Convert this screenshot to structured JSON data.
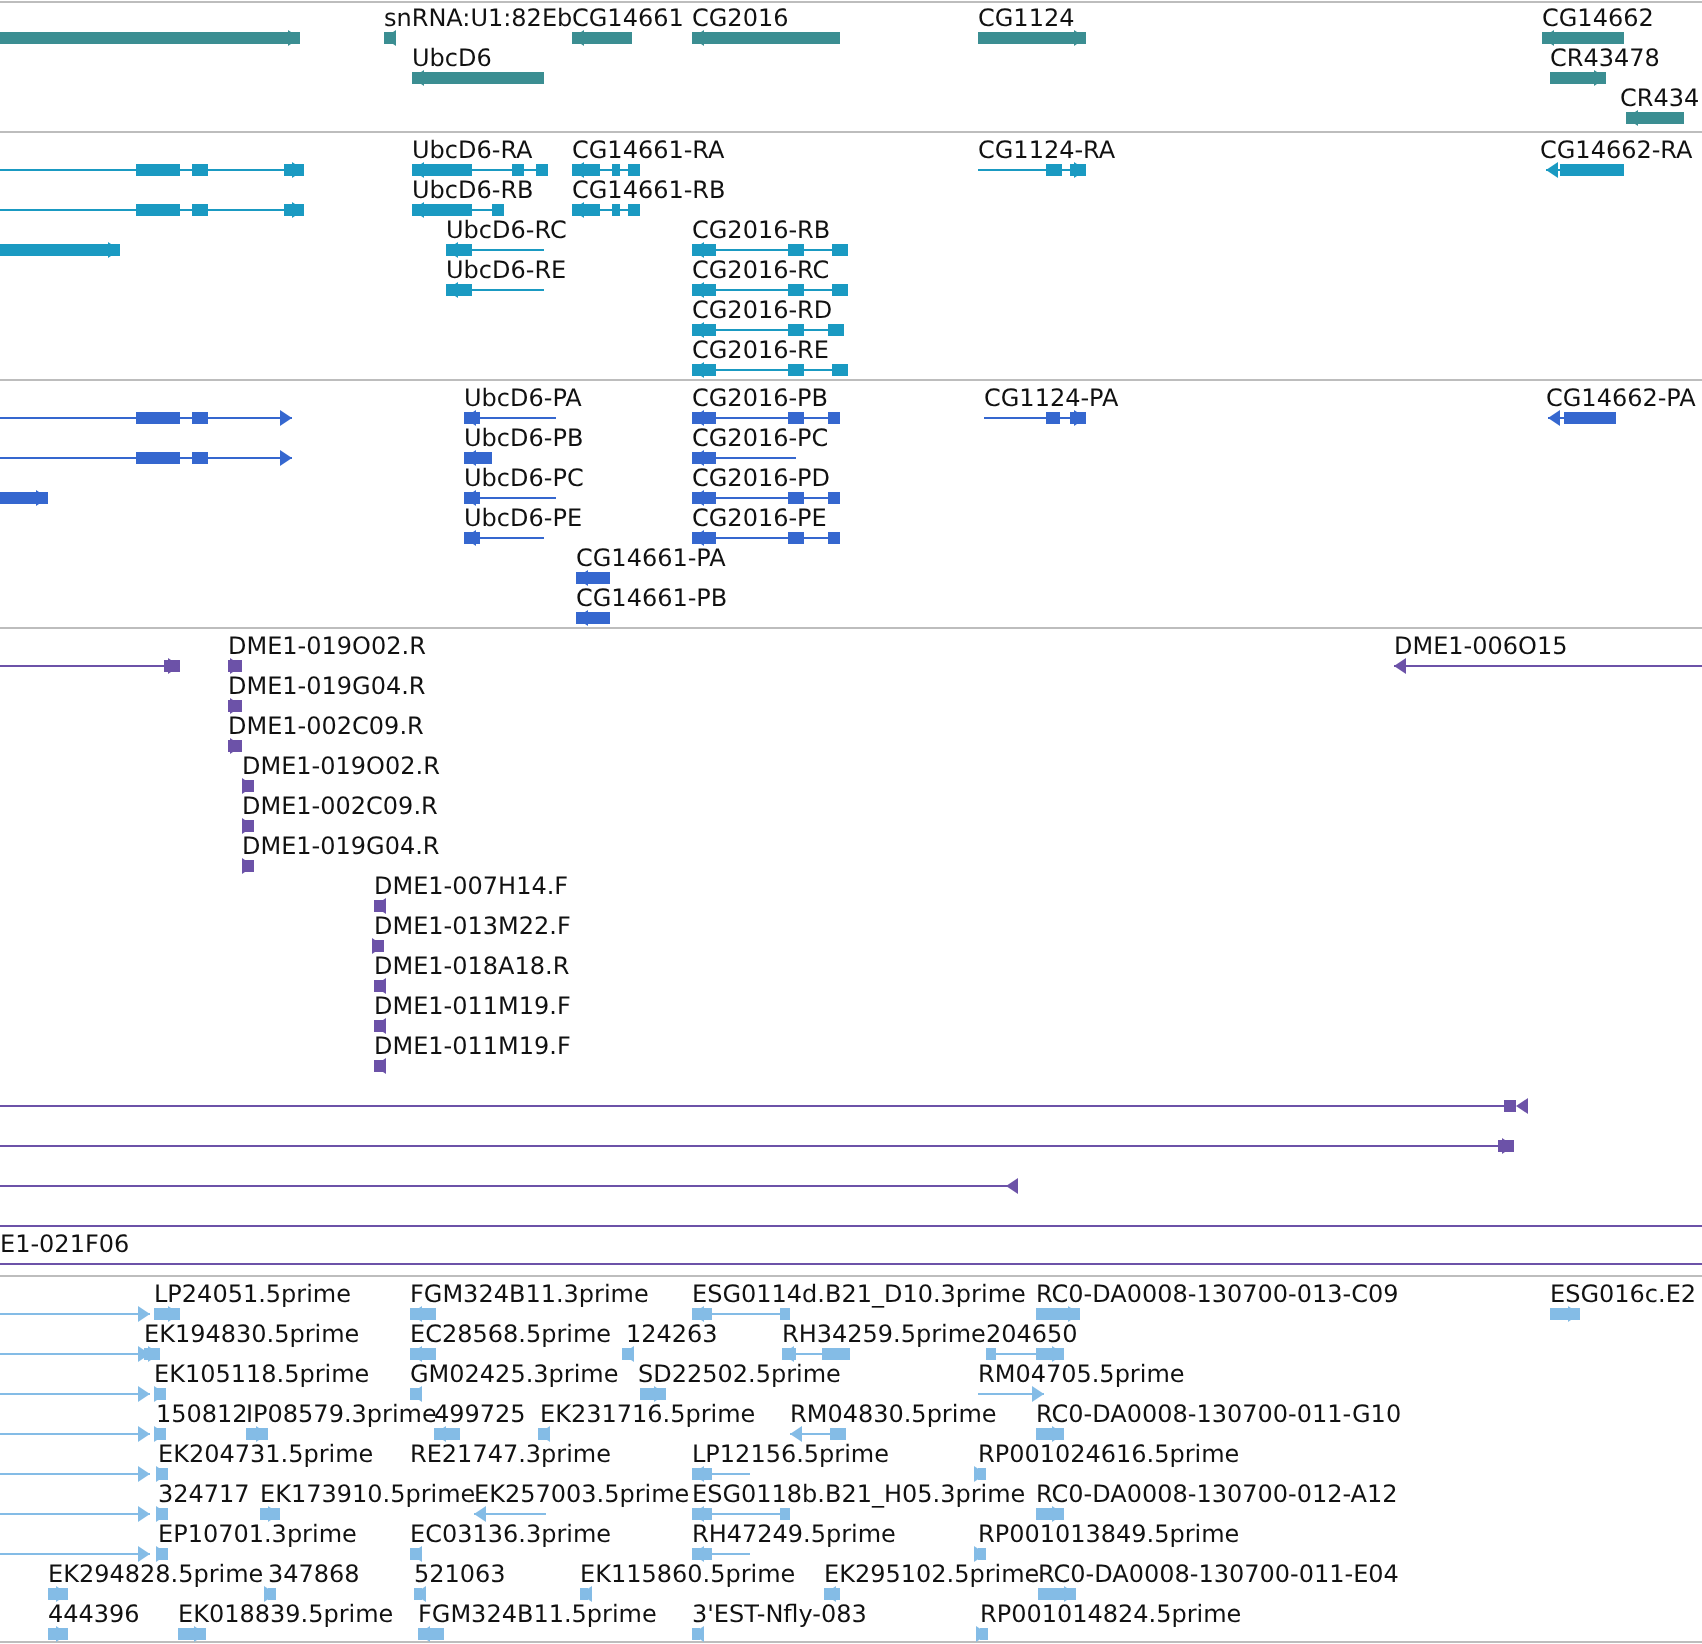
{
  "tracks": [
    {
      "kind": "gene",
      "features": [
        {
          "reverse": false
        },
        {
          "label": "snRNA:U1:82Eb",
          "reverse": true
        },
        {
          "label": "CG14661",
          "reverse": true
        },
        {
          "label": "CG2016",
          "reverse": true
        },
        {
          "label": "CG1124",
          "reverse": false
        },
        {
          "label": "CG14662",
          "reverse": true
        },
        {
          "label": "UbcD6",
          "reverse": true
        },
        {
          "label": "CR43478",
          "reverse": false
        },
        {
          "label": "CR434",
          "reverse": true
        }
      ]
    },
    {
      "kind": "transcript",
      "features": [
        {
          "reverse": false
        },
        {
          "reverse": false
        },
        {
          "reverse": false
        },
        {
          "label": "UbcD6-RA",
          "reverse": true
        },
        {
          "label": "CG14661-RA",
          "reverse": true
        },
        {
          "label": "CG1124-RA",
          "reverse": false
        },
        {
          "label": "CG14662-RA",
          "reverse": true
        },
        {
          "label": "UbcD6-RB",
          "reverse": true
        },
        {
          "label": "CG14661-RB",
          "reverse": true
        },
        {
          "label": "UbcD6-RC",
          "reverse": true
        },
        {
          "label": "UbcD6-RE",
          "reverse": true
        },
        {
          "label": "CG2016-RB",
          "reverse": true
        },
        {
          "label": "CG2016-RC",
          "reverse": true
        },
        {
          "label": "CG2016-RD",
          "reverse": true
        },
        {
          "label": "CG2016-RE",
          "reverse": true
        }
      ]
    },
    {
      "kind": "protein",
      "features": [
        {
          "reverse": false
        },
        {
          "reverse": false
        },
        {
          "reverse": false
        },
        {
          "label": "UbcD6-PA",
          "reverse": true
        },
        {
          "label": "CG2016-PB",
          "reverse": true
        },
        {
          "label": "CG1124-PA",
          "reverse": false
        },
        {
          "label": "CG14662-PA",
          "reverse": true
        },
        {
          "label": "UbcD6-PB",
          "reverse": true
        },
        {
          "label": "CG2016-PC",
          "reverse": true
        },
        {
          "label": "UbcD6-PC",
          "reverse": true
        },
        {
          "label": "CG2016-PD",
          "reverse": true
        },
        {
          "label": "UbcD6-PE",
          "reverse": true
        },
        {
          "label": "CG2016-PE",
          "reverse": true
        },
        {
          "label": "CG14661-PA",
          "reverse": true
        },
        {
          "label": "CG14661-PB",
          "reverse": true
        }
      ]
    },
    {
      "kind": "clone",
      "features": [
        {
          "reverse": false
        },
        {
          "label": "DME1-019O02.R",
          "reverse": false
        },
        {
          "label": "DME1-006O15",
          "reverse": true
        },
        {
          "label": "DME1-019G04.R",
          "reverse": false
        },
        {
          "label": "DME1-002C09.R",
          "reverse": false
        },
        {
          "label": "DME1-019O02.R",
          "reverse": false
        },
        {
          "label": "DME1-002C09.R",
          "reverse": false
        },
        {
          "label": "DME1-019G04.R",
          "reverse": false
        },
        {
          "label": "DME1-007H14.F",
          "reverse": true
        },
        {
          "label": "DME1-013M22.F",
          "reverse": false
        },
        {
          "label": "DME1-018A18.R",
          "reverse": true
        },
        {
          "label": "DME1-011M19.F",
          "reverse": true
        },
        {
          "label": "DME1-011M19.F",
          "reverse": true
        },
        {
          "reverse": true
        },
        {
          "reverse": false
        },
        {
          "reverse": true
        },
        {
          "reverse": false
        },
        {
          "label": "E1-021F06",
          "reverse": false
        }
      ]
    },
    {
      "kind": "est",
      "features": [
        {
          "reverse": false
        },
        {
          "label": "LP24051.5prime",
          "reverse": false
        },
        {
          "label": "FGM324B11.3prime",
          "reverse": true
        },
        {
          "label": "ESG0114d.B21_D10.3prime",
          "reverse": true
        },
        {
          "label": "RC0-DA0008-130700-013-C09",
          "reverse": false
        },
        {
          "label": "ESG016c.E2",
          "reverse": false
        },
        {
          "reverse": false
        },
        {
          "label": "EK194830.5prime",
          "reverse": false
        },
        {
          "label": "EC28568.5prime",
          "reverse": true
        },
        {
          "label": "124263",
          "reverse": true
        },
        {
          "label": "RH34259.5prime",
          "reverse": true
        },
        {
          "label": "204650",
          "reverse": false
        },
        {
          "reverse": false
        },
        {
          "label": "EK105118.5prime",
          "reverse": false
        },
        {
          "label": "GM02425.3prime",
          "reverse": true
        },
        {
          "label": "SD22502.5prime",
          "reverse": false
        },
        {
          "label": "RM04705.5prime",
          "reverse": false
        },
        {
          "reverse": false
        },
        {
          "label": "150812",
          "reverse": false
        },
        {
          "label": "IP08579.3prime",
          "reverse": false
        },
        {
          "label": "499725",
          "reverse": true
        },
        {
          "label": "EK231716.5prime",
          "reverse": true
        },
        {
          "label": "RM04830.5prime",
          "reverse": true
        },
        {
          "label": "RC0-DA0008-130700-011-G10",
          "reverse": false
        },
        {
          "reverse": false
        },
        {
          "label": "EK204731.5prime",
          "reverse": false
        },
        {
          "label": "RE21747.3prime"
        },
        {
          "label": "LP12156.5prime",
          "reverse": true
        },
        {
          "label": "RP001024616.5prime",
          "reverse": false
        },
        {
          "reverse": false
        },
        {
          "label": "324717",
          "reverse": false
        },
        {
          "label": "EK173910.5prime",
          "reverse": false
        },
        {
          "label": "EK257003.5prime",
          "reverse": true
        },
        {
          "label": "ESG0118b.B21_H05.3prime",
          "reverse": true
        },
        {
          "label": "RC0-DA0008-130700-012-A12",
          "reverse": false
        },
        {
          "reverse": false
        },
        {
          "label": "EP10701.3prime",
          "reverse": false
        },
        {
          "label": "EC03136.3prime",
          "reverse": true
        },
        {
          "label": "RH47249.5prime",
          "reverse": true
        },
        {
          "label": "RP001013849.5prime",
          "reverse": false
        },
        {
          "label": "EK294828.5prime",
          "reverse": false
        },
        {
          "label": "347868",
          "reverse": false
        },
        {
          "label": "521063",
          "reverse": true
        },
        {
          "label": "EK115860.5prime",
          "reverse": true
        },
        {
          "label": "EK295102.5prime",
          "reverse": true
        },
        {
          "label": "RC0-DA0008-130700-011-E04",
          "reverse": false
        },
        {
          "label": "444396",
          "reverse": false
        },
        {
          "label": "EK018839.5prime",
          "reverse": false
        },
        {
          "label": "FGM324B11.5prime",
          "reverse": true
        },
        {
          "label": "3'EST-Nfly-083",
          "reverse": true
        },
        {
          "label": "RP001014824.5prime",
          "reverse": false
        }
      ]
    }
  ]
}
